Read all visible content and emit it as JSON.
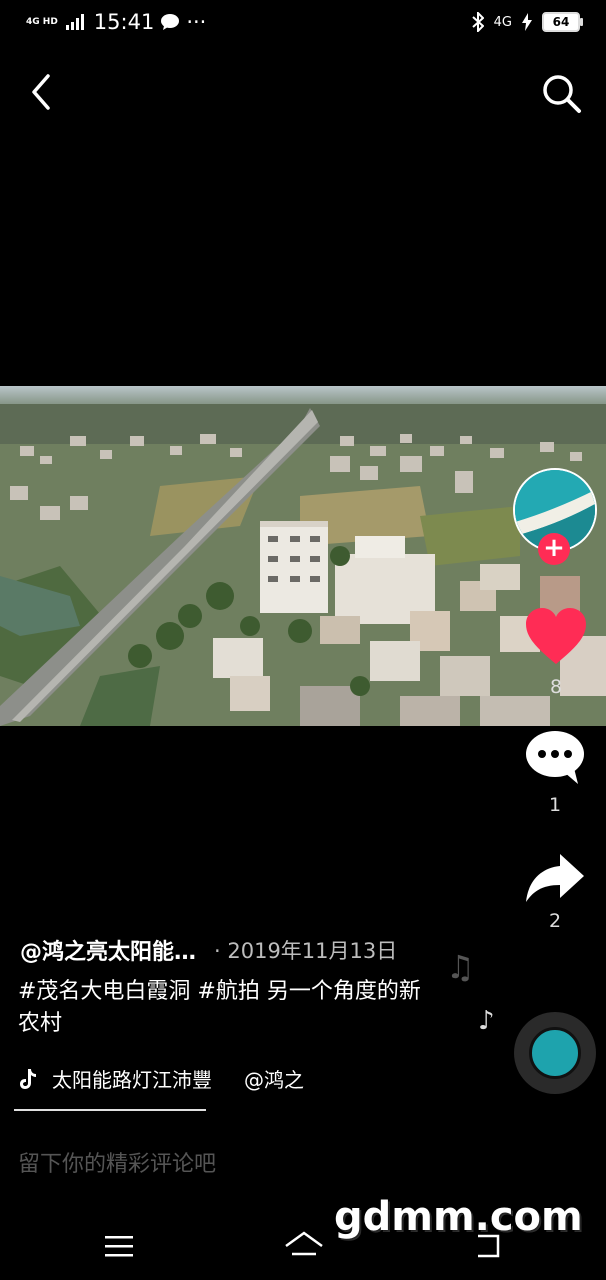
{
  "status_bar": {
    "network_type": "4G HD",
    "time": "15:41",
    "overflow_dots": "···",
    "mobile_data": "4G",
    "battery": "64"
  },
  "video": {
    "author": "@鸿之亮太阳能…",
    "date": "· 2019年11月13日",
    "caption": "#茂名大电白霞洞 #航拍 另一个角度的新农村",
    "music_title": "太阳能路灯江沛豐",
    "music_author_partial": "@鸿之",
    "likes": "8",
    "comments": "1",
    "shares": "2"
  },
  "comment_input": {
    "placeholder": "留下你的精彩评论吧"
  },
  "watermark": "gdmm.com"
}
